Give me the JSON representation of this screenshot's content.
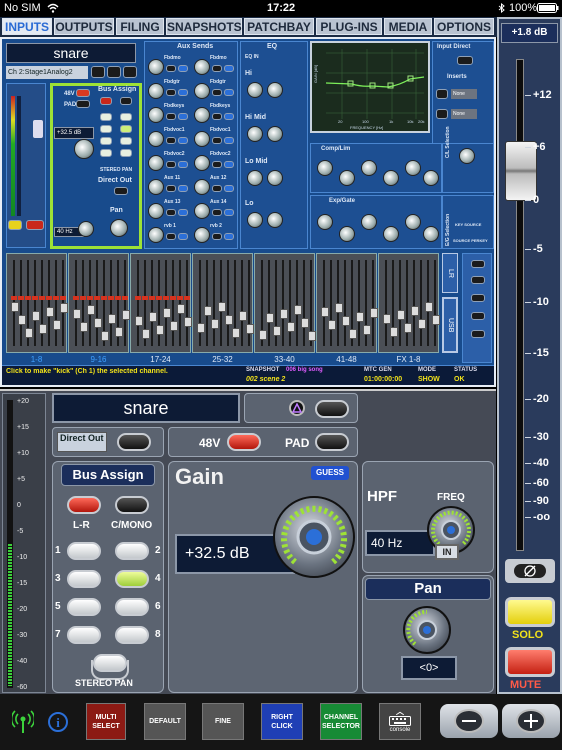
{
  "status_bar": {
    "carrier": "No SIM",
    "time": "17:22",
    "battery": "100%"
  },
  "tabs": [
    {
      "label": "INPUTS",
      "active": true
    },
    {
      "label": "OUTPUTS",
      "active": false
    },
    {
      "label": "FILING",
      "active": false
    },
    {
      "label": "SNAPSHOTS",
      "active": false
    },
    {
      "label": "PATCHBAY",
      "active": false
    },
    {
      "label": "PLUG-INS",
      "active": false
    },
    {
      "label": "MEDIA",
      "active": false
    },
    {
      "label": "OPTIONS",
      "active": false
    }
  ],
  "overview": {
    "channel_name": "snare",
    "channel_source": "Ch 2:Stage1Analog2",
    "bus_assign_label": "Bus Assign",
    "direct_out_label": "Direct Out",
    "pan_label": "Pan",
    "stereo_pan_label": "STEREO PAN",
    "aux_sends_label": "Aux Sends",
    "eq_label": "EQ",
    "eq_in": "EQ IN",
    "eq_bands": [
      "Hi",
      "Hi Mid",
      "Lo Mid",
      "Lo"
    ],
    "input_direct_label": "Input Direct",
    "inserts_label": "Inserts",
    "insert_slots": [
      "None",
      "None"
    ],
    "comp_label": "Comp/Lim",
    "gate_label": "Exp/Gate",
    "cl_selection": "C/L Selection",
    "eg_selection": "E/G Selection",
    "key_source": "KEY SOURCE",
    "source_prompt": "SOURCE PERKEY",
    "side_buttons": [
      "LR",
      "USB"
    ],
    "graph_xlabel": "FREQUENCY [Hz]",
    "graph_ylabel": "GAIN [dB]",
    "graph_ticks": [
      "20",
      "100",
      "1k",
      "10k",
      "20k"
    ],
    "aux_sends": [
      "Fbdmo",
      "Fbdmo",
      "Fbdgtr",
      "Fbdgtr",
      "Fbdkeys",
      "Fbdkeys",
      "Fbdvoc1",
      "Fbdvoc1",
      "Fbdvoc2",
      "Fbdvoc2",
      "Aux 11",
      "Aux 12",
      "Aux 13",
      "Aux 14",
      "rvb 1",
      "rvb 2"
    ],
    "fader_banks": [
      "1-8",
      "9-16",
      "17-24",
      "25-32",
      "33-40",
      "41-48",
      "FX 1-8"
    ],
    "info_text": "Click to make \"kick\" (Ch 1) the selected channel.",
    "snapshot_label": "SNAPSHOT",
    "snapshot_value": "006 big song",
    "scene_value": "002 scene 2",
    "mtc_label": "MTC GEN",
    "mtc_value": "01:00:00:00",
    "mode_label": "MODE",
    "mode_value": "SHOW",
    "status_label": "STATUS",
    "status_value": "OK",
    "mini_gain_value": "+32.5 dB",
    "mini_hpf_value": "40 Hz"
  },
  "detail": {
    "channel_name": "snare",
    "direct_out_label": "Direct Out",
    "phantom_label": "48V",
    "pad_label": "PAD",
    "bus_assign_label": "Bus Assign",
    "lr_label": "L-R",
    "cmono_label": "C/MONO",
    "bus_numbers": [
      "1",
      "2",
      "3",
      "4",
      "5",
      "6",
      "7",
      "8"
    ],
    "bus_states": [
      false,
      false,
      false,
      true,
      false,
      false,
      false,
      false
    ],
    "stereo_pan_label": "STEREO PAN",
    "gain_label": "Gain",
    "guess_label": "GUESS",
    "gain_value": "+32.5 dB",
    "hpf_label": "HPF",
    "freq_label": "FREQ",
    "hpf_value": "40 Hz",
    "hpf_in_label": "IN",
    "pan_label": "Pan",
    "pan_value": "<0>",
    "meter_scale": [
      "+20",
      "+15",
      "+10",
      "+5",
      "0",
      "-5",
      "-10",
      "-15",
      "-20",
      "-30",
      "-40",
      "-60"
    ]
  },
  "master": {
    "level_readout": "+1.8 dB",
    "scale": [
      "+12",
      "+6",
      "0",
      "-5",
      "-10",
      "-15",
      "-20",
      "-30",
      "-40",
      "-60",
      "-90",
      "-oo"
    ],
    "solo_label": "SOLO",
    "mute_label": "MUTE"
  },
  "toolbar": {
    "multi_select": "MULTI\nSELECT",
    "default": "DEFAULT",
    "fine": "FINE",
    "right_click": "RIGHT\nCLICK",
    "channel_selector": "CHANNEL\nSELECTOR",
    "console": "console"
  },
  "colors": {
    "panel_blue": "#184b8c",
    "accent_green": "#9ee236",
    "mute_red": "#d6321e",
    "solo_yellow": "#f2e21a",
    "multi_select_red": "#8c1a14",
    "right_click_blue": "#1f3fb5",
    "channel_selector_green": "#178a35"
  }
}
